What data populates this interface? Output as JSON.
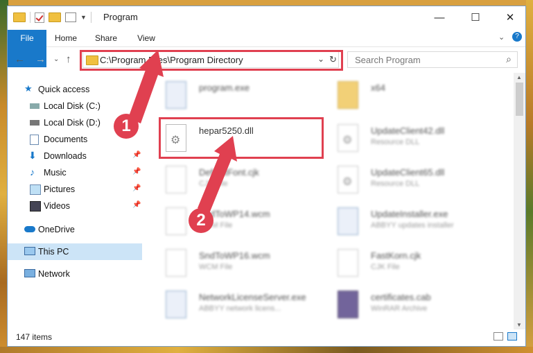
{
  "window": {
    "title": "Program"
  },
  "ribbon": {
    "tabs": [
      "File",
      "Home",
      "Share",
      "View"
    ]
  },
  "address": {
    "path": "C:\\Program Files\\Program Directory"
  },
  "search": {
    "placeholder": "Search Program"
  },
  "nav": [
    {
      "label": "Quick access",
      "icon": "star-icon"
    },
    {
      "label": "Local Disk (C:)",
      "icon": "drive-icon"
    },
    {
      "label": "Local Disk (D:)",
      "icon": "drive-icon"
    },
    {
      "label": "Documents",
      "icon": "document-icon"
    },
    {
      "label": "Downloads",
      "icon": "download-icon"
    },
    {
      "label": "Music",
      "icon": "music-icon"
    },
    {
      "label": "Pictures",
      "icon": "picture-icon"
    },
    {
      "label": "Videos",
      "icon": "video-icon"
    },
    {
      "label": "OneDrive",
      "icon": "cloud-icon"
    },
    {
      "label": "This PC",
      "icon": "computer-icon"
    },
    {
      "label": "Network",
      "icon": "network-icon"
    }
  ],
  "files": [
    {
      "name": "program.exe",
      "type": ""
    },
    {
      "name": "x64",
      "type": ""
    },
    {
      "name": "hepar5250.dll",
      "type": ""
    },
    {
      "name": "UpdateClient42.dll",
      "type": "Resource DLL"
    },
    {
      "name": "DefaultFont.cjk",
      "type": "CJK File"
    },
    {
      "name": "UpdateClient65.dll",
      "type": "Resource DLL"
    },
    {
      "name": "SndToWP14.wcm",
      "type": "WCM File"
    },
    {
      "name": "UpdateInstaller.exe",
      "type": "ABBYY updates installer"
    },
    {
      "name": "SndToWP16.wcm",
      "type": "WCM File"
    },
    {
      "name": "FastKorn.cjk",
      "type": "CJK File"
    },
    {
      "name": "NetworkLicenseServer.exe",
      "type": "ABBYY network licens..."
    },
    {
      "name": "certificates.cab",
      "type": "WinRAR Archive"
    }
  ],
  "status": {
    "items": "147 items"
  },
  "annotations": {
    "step1": "1",
    "step2": "2"
  },
  "colors": {
    "accent": "#1979ca",
    "highlight": "#e04050"
  }
}
